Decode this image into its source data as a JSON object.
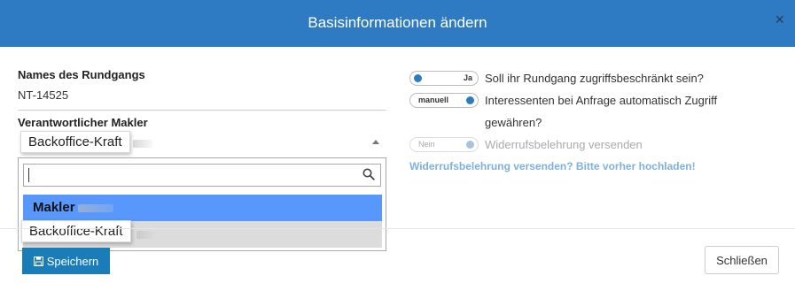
{
  "dialog": {
    "title": "Basisinformationen ändern",
    "close_icon": "×"
  },
  "form": {
    "name_label": "Names des Rundgangs",
    "name_value": "NT-14525",
    "makler_label": "Verantwortlicher Makler",
    "makler_selected": "Backoffice-Kraft",
    "dropdown": {
      "search_value": "",
      "options": [
        {
          "label": "Makler",
          "selected": true
        },
        {
          "label": "Backoffice-Kraft",
          "selected": false
        }
      ]
    }
  },
  "toggles": [
    {
      "state_label": "Ja",
      "text": "Soll ihr Rundgang zugriffsbeschränkt sein?",
      "enabled": true
    },
    {
      "state_label": "manuell",
      "text_line1": "Interessenten bei Anfrage automatisch Zugriff",
      "text_line2": "gewähren?",
      "enabled": true
    },
    {
      "state_label": "Nein",
      "text": "Widerrufsbelehrung versenden",
      "enabled": false
    }
  ],
  "upload_link": "Widerrufsbelehrung versenden? Bitte vorher hochladen!",
  "footer": {
    "save_label": "Speichern",
    "close_label": "Schließen"
  },
  "colors": {
    "header": "#2e7bc4",
    "selected_option": "#5897fb",
    "save_button": "#1a7db8",
    "link": "#7fb1da"
  }
}
